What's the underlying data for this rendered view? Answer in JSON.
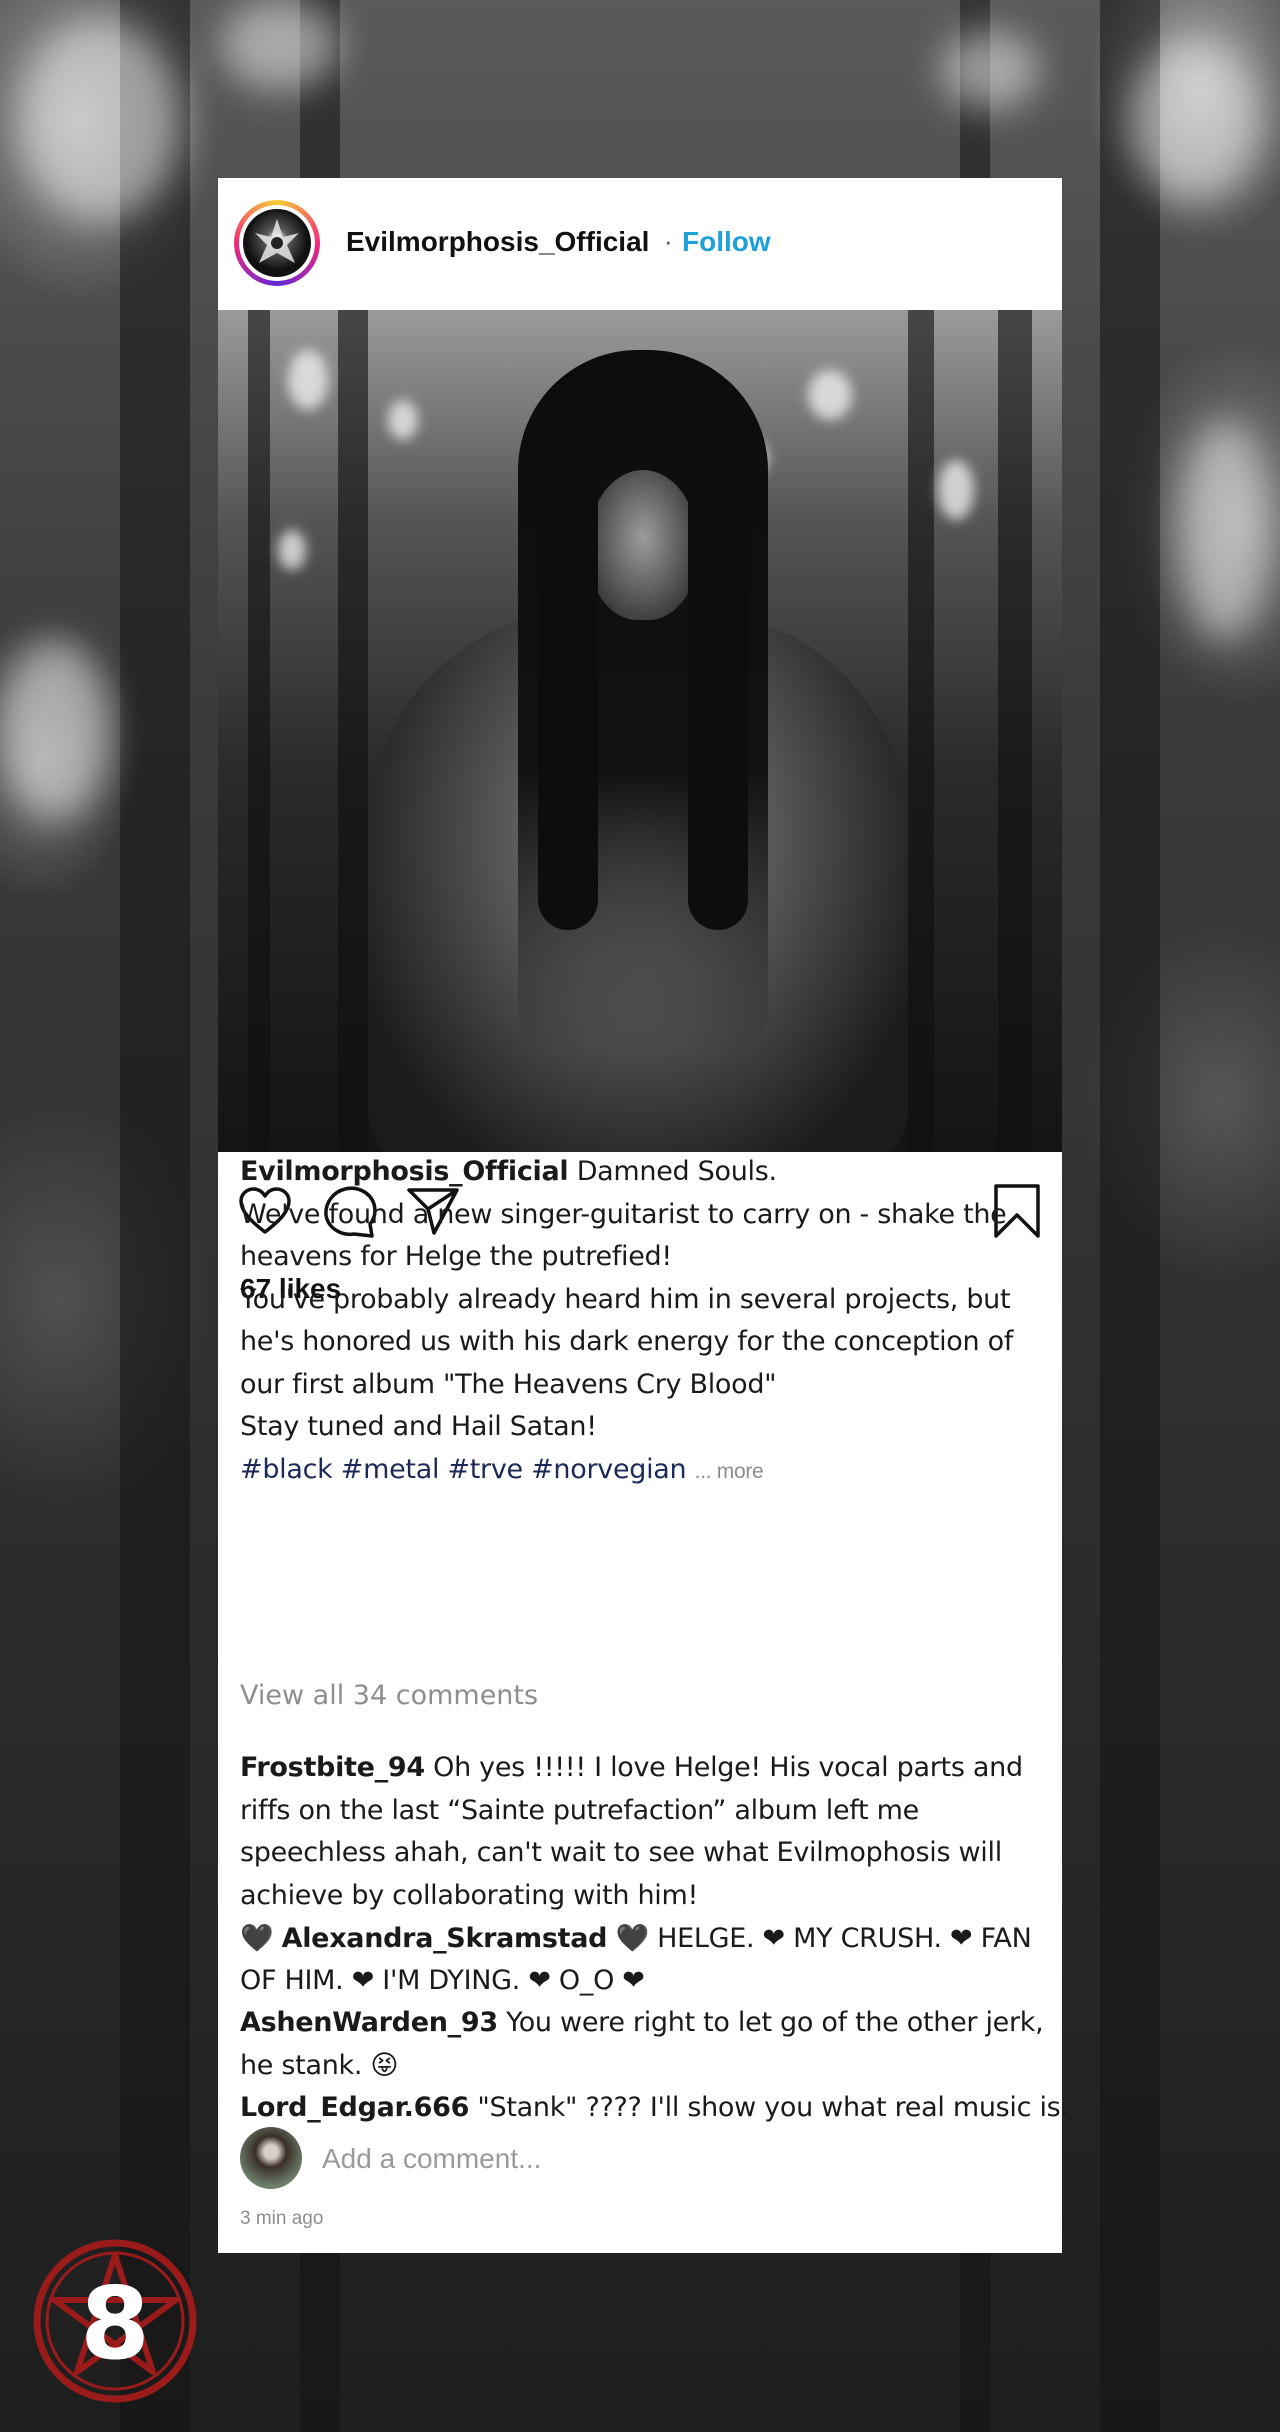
{
  "post": {
    "account": {
      "username": "Evilmorphosis_Official",
      "separator": "·",
      "follow_label": "Follow"
    },
    "likes": "67 likes",
    "caption": {
      "username": "Evilmorphosis_Official",
      "lines": [
        "Damned Souls.",
        "We've found a new singer-guitarist to carry on - shake the",
        "heavens for Helge the putrefied!",
        "You've probably already heard him in several projects, but",
        "he's honored us with his dark energy for the conception of",
        "our first album \"The Heavens Cry Blood\"",
        "Stay tuned and Hail Satan!"
      ],
      "hashtags": "#black #metal #trve #norvegian",
      "more_label": "... more"
    },
    "view_comments_label": "View all 34 comments",
    "comments": [
      {
        "username": "Frostbite_94",
        "lines": [
          "Oh yes !!!!! I love Helge! His vocal parts and",
          "riffs on the last “Sainte putrefaction” album left me",
          "speechless ahah, can't wait to see what Evilmophosis will",
          "achieve by collaborating with him!"
        ]
      },
      {
        "username": "Alexandra_Skramstad",
        "prefix": "🖤",
        "lines": [
          "🖤  HELGE. ❤ MY CRUSH. ❤ FAN",
          "OF HIM. ❤ I'M DYING. ❤ O_O ❤"
        ]
      },
      {
        "username": "AshenWarden_93",
        "lines": [
          "You were right to let go of the other jerk,",
          "he stank. 😝"
        ]
      },
      {
        "username": "Lord_Edgar.666",
        "lines": [
          "\"Stank\" ???? I'll show you what real music is."
        ]
      }
    ],
    "add_comment_placeholder": "Add a comment...",
    "timestamp": "3 min ago"
  },
  "badge": {
    "number": "8",
    "color": "#9b1b1b"
  },
  "icons": [
    "heart-icon",
    "comment-icon",
    "share-icon",
    "bookmark-icon"
  ],
  "colors": {
    "follow": "#1da1d6",
    "hashtag": "#1c2a5a",
    "muted": "#8e8e8e"
  }
}
